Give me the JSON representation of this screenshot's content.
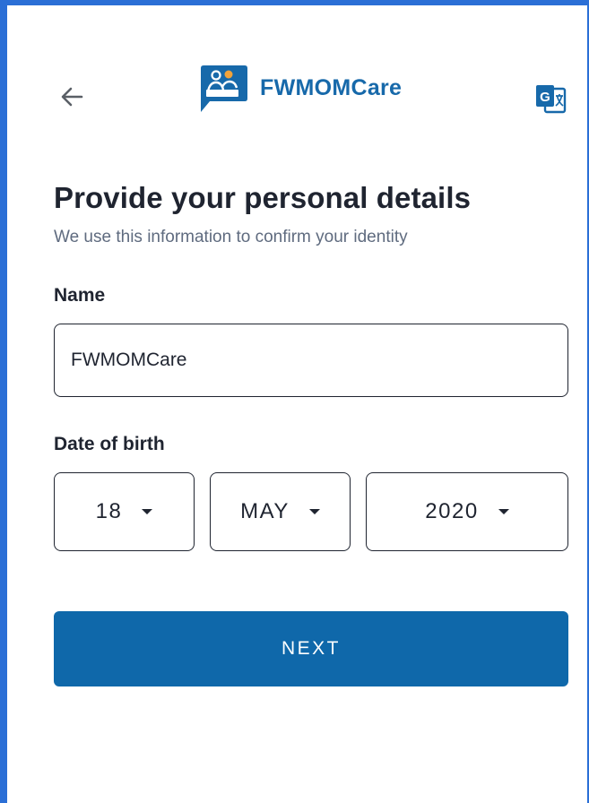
{
  "header": {
    "back_icon": "arrow-left-icon",
    "app_name": "FWMOMCare",
    "logo_icon": "fwmomcare-logo-icon",
    "translate_icon": "google-translate-icon"
  },
  "main": {
    "title": "Provide your personal details",
    "subtitle": "We use this information to confirm your identity",
    "name_label": "Name",
    "name_value": "FWMOMCare",
    "dob_label": "Date of birth",
    "dob": {
      "day": "18",
      "month": "MAY",
      "year": "2020"
    },
    "next_label": "NEXT"
  },
  "colors": {
    "brand": "#1769aa",
    "button": "#0f68aa",
    "frame": "#2b6fd6",
    "text": "#1f2430",
    "subtitle": "#5f6b7f"
  }
}
